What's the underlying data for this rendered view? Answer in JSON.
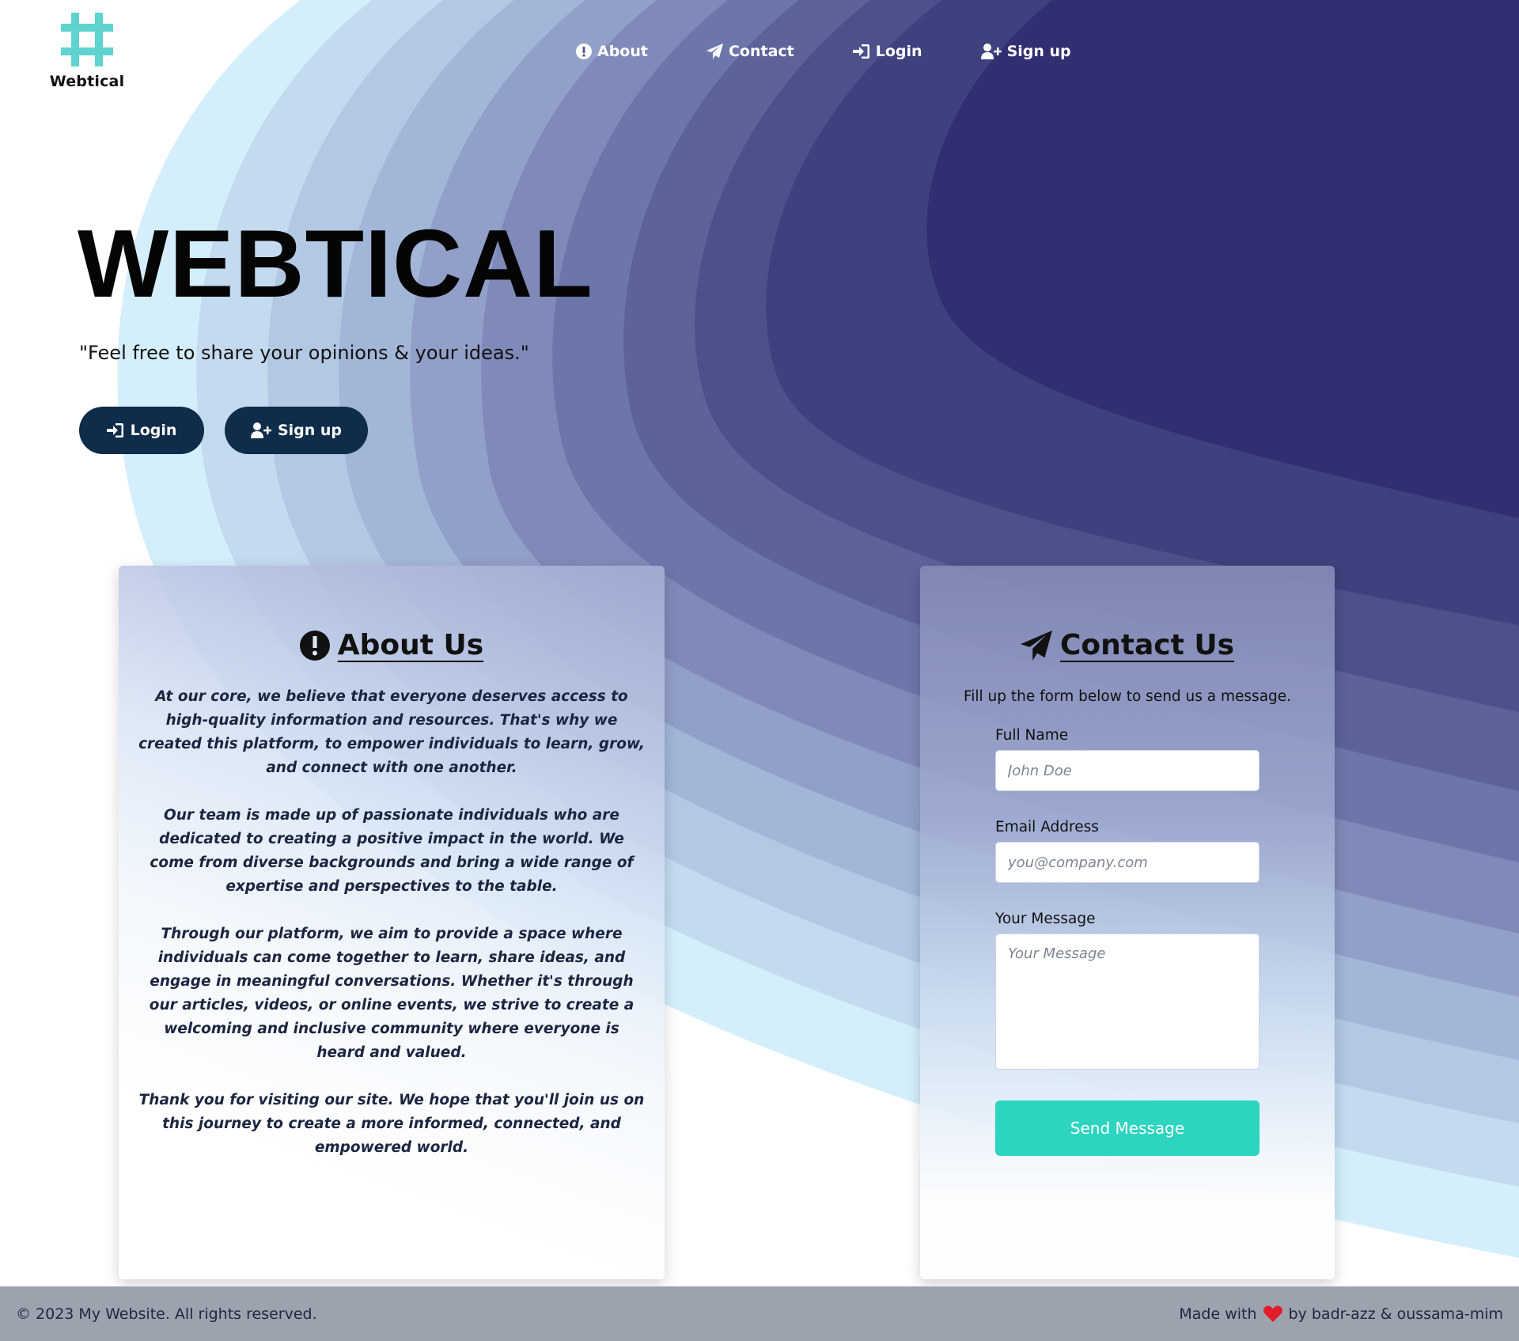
{
  "brand": {
    "name": "Webtical",
    "accent": "#5fd3cf",
    "navy": "#0f2c4a",
    "teal": "#2dd4bf"
  },
  "nav": {
    "about": "About",
    "contact": "Contact",
    "login": "Login",
    "signup": "Sign up"
  },
  "hero": {
    "title": "WEBTICAL",
    "quote": "\"Feel free to share your opinions & your ideas.\"",
    "login_label": "Login",
    "signup_label": "Sign up"
  },
  "about": {
    "title": "About Us",
    "paragraphs": [
      "At our core, we believe that everyone deserves access to high-quality information and resources. That's why we created this platform, to empower individuals to learn, grow, and connect with one another.",
      "Our team is made up of passionate individuals who are dedicated to creating a positive impact in the world. We come from diverse backgrounds and bring a wide range of expertise and perspectives to the table.",
      "Through our platform, we aim to provide a space where individuals can come together to learn, share ideas, and engage in meaningful conversations. Whether it's through our articles, videos, or online events, we strive to create a welcoming and inclusive community where everyone is heard and valued.",
      "Thank you for visiting our site. We hope that you'll join us on this journey to create a more informed, connected, and empowered world."
    ]
  },
  "contact": {
    "title": "Contact Us",
    "subtitle": "Fill up the form below to send us a message.",
    "name_label": "Full Name",
    "name_placeholder": "John Doe",
    "email_label": "Email Address",
    "email_placeholder": "you@company.com",
    "message_label": "Your Message",
    "message_placeholder": "Your Message",
    "send_label": "Send Message"
  },
  "footer": {
    "copyright": "© 2023 My Website. All rights reserved.",
    "made_with": "Made with",
    "by": "by badr-azz & oussama-mim"
  }
}
